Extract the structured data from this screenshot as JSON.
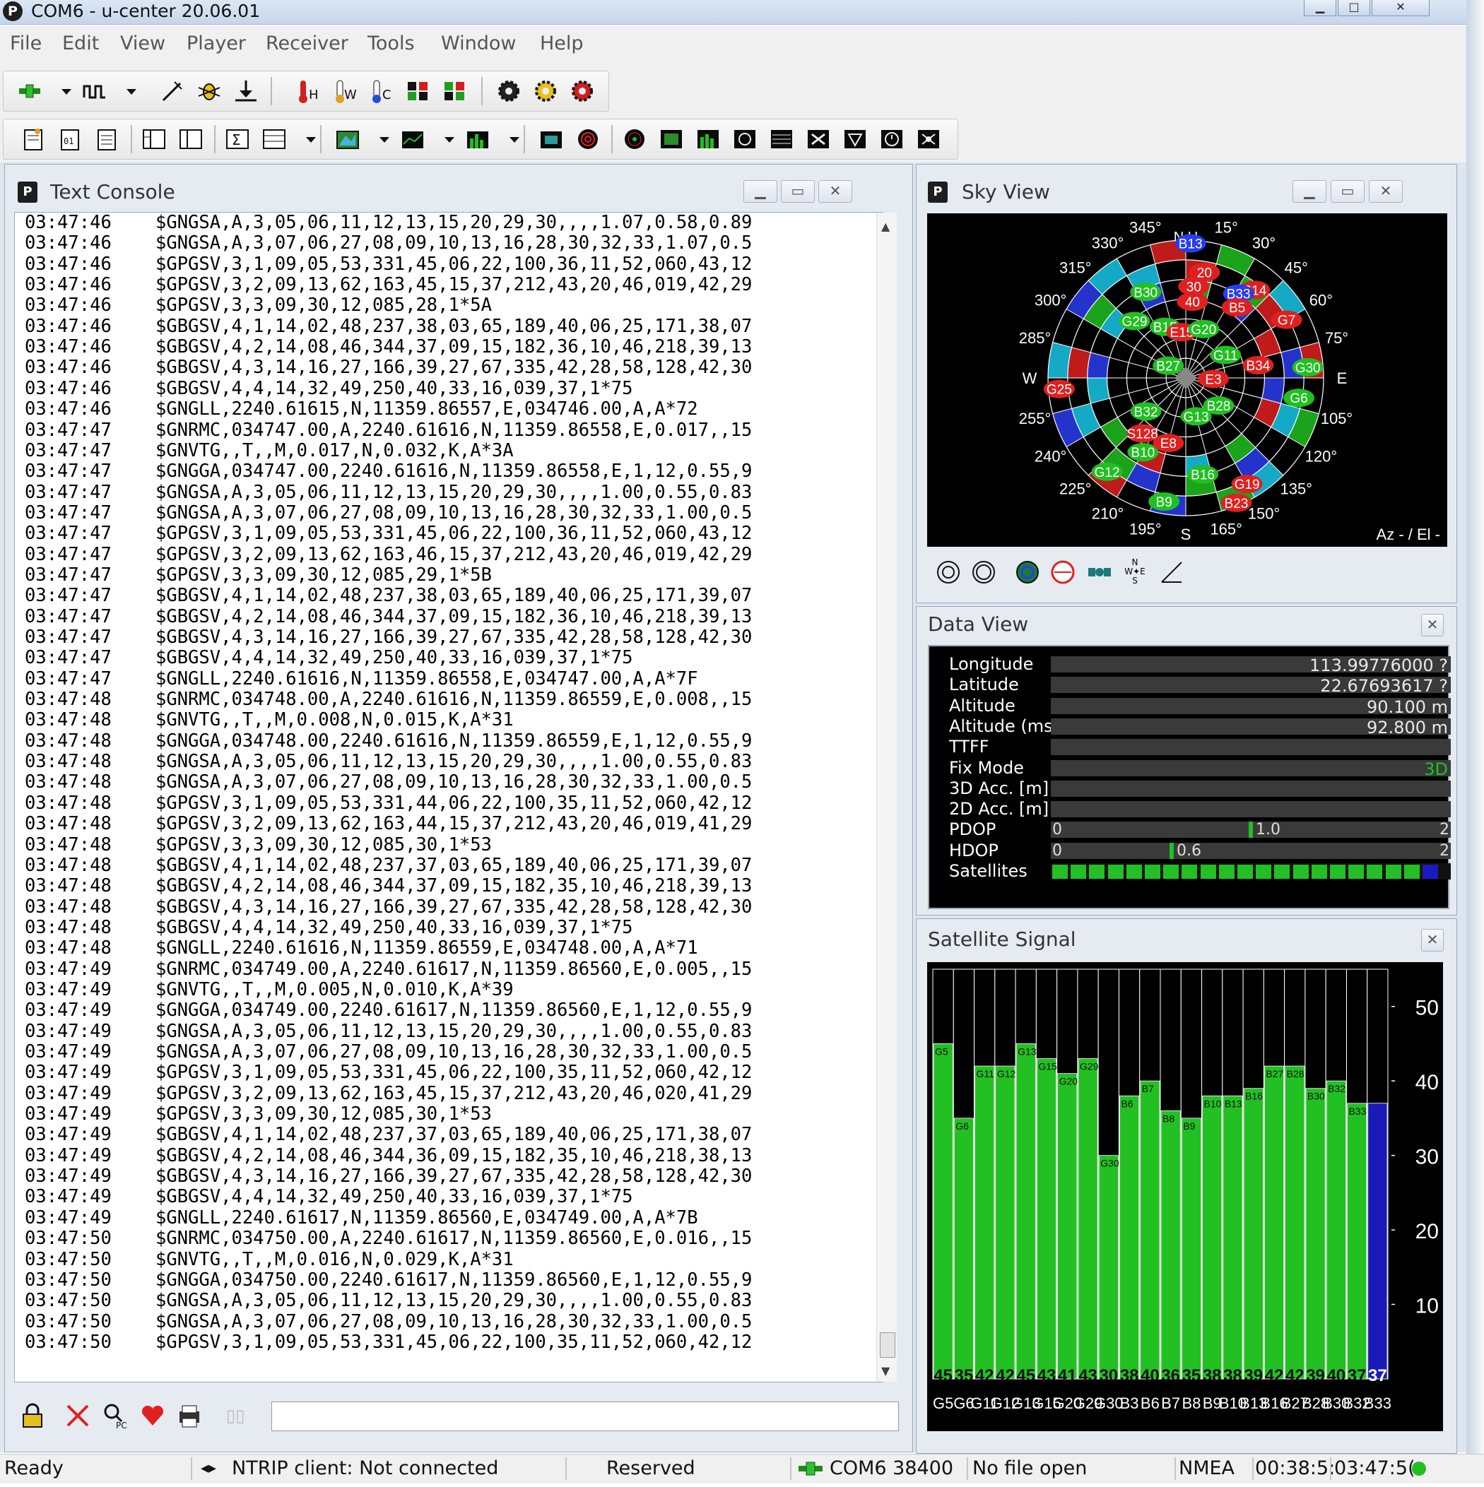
{
  "window": {
    "title": "COM6 - u-center 20.06.01",
    "app_icon": "P"
  },
  "menu": [
    "File",
    "Edit",
    "View",
    "Player",
    "Receiver",
    "Tools",
    "Window",
    "Help"
  ],
  "toolbar1_icons": [
    "connection-icon",
    "dropdown-icon",
    "baudrate-icon",
    "dropdown-icon",
    "autobaud-icon",
    "debug-icon",
    "download-icon",
    "hot-start-icon",
    "warm-start-icon",
    "cold-start-icon",
    "ubx-msg-icon",
    "ubx-cfg-icon",
    "gear-config-icon",
    "gear-send-icon",
    "gear-reset-icon"
  ],
  "toolbar2_icons": [
    "packet-console-icon",
    "binary-console-icon",
    "text-console-icon",
    "messages-view-icon",
    "data-view-icon",
    "statistics-icon",
    "table-view-icon",
    "dropdown-icon",
    "map-view-icon",
    "dropdown-icon",
    "chart-view-icon",
    "dropdown-icon",
    "histogram-icon",
    "dropdown-icon",
    "camera-view-icon",
    "sky-view-icon",
    "compass-icon",
    "deviation-map-icon",
    "signal-bars-icon",
    "spectrum-icon",
    "table-icon",
    "satellite-icon",
    "nav-icon",
    "clock-icon",
    "antenna-icon"
  ],
  "text_console": {
    "title": "Text Console",
    "lines": [
      [
        "03:47:46",
        "$GNGSA,A,3,05,06,11,12,13,15,20,29,30,,,,1.07,0.58,0.89"
      ],
      [
        "03:47:46",
        "$GNGSA,A,3,07,06,27,08,09,10,13,16,28,30,32,33,1.07,0.5"
      ],
      [
        "03:47:46",
        "$GPGSV,3,1,09,05,53,331,45,06,22,100,36,11,52,060,43,12"
      ],
      [
        "03:47:46",
        "$GPGSV,3,2,09,13,62,163,45,15,37,212,43,20,46,019,42,29"
      ],
      [
        "03:47:46",
        "$GPGSV,3,3,09,30,12,085,28,1*5A"
      ],
      [
        "03:47:46",
        "$GBGSV,4,1,14,02,48,237,38,03,65,189,40,06,25,171,38,07"
      ],
      [
        "03:47:46",
        "$GBGSV,4,2,14,08,46,344,37,09,15,182,36,10,46,218,39,13"
      ],
      [
        "03:47:46",
        "$GBGSV,4,3,14,16,27,166,39,27,67,335,42,28,58,128,42,30"
      ],
      [
        "03:47:46",
        "$GBGSV,4,4,14,32,49,250,40,33,16,039,37,1*75"
      ],
      [
        "03:47:46",
        "$GNGLL,2240.61615,N,11359.86557,E,034746.00,A,A*72"
      ],
      [
        "03:47:47",
        "$GNRMC,034747.00,A,2240.61616,N,11359.86558,E,0.017,,15"
      ],
      [
        "03:47:47",
        "$GNVTG,,T,,M,0.017,N,0.032,K,A*3A"
      ],
      [
        "03:47:47",
        "$GNGGA,034747.00,2240.61616,N,11359.86558,E,1,12,0.55,9"
      ],
      [
        "03:47:47",
        "$GNGSA,A,3,05,06,11,12,13,15,20,29,30,,,,1.00,0.55,0.83"
      ],
      [
        "03:47:47",
        "$GNGSA,A,3,07,06,27,08,09,10,13,16,28,30,32,33,1.00,0.5"
      ],
      [
        "03:47:47",
        "$GPGSV,3,1,09,05,53,331,45,06,22,100,36,11,52,060,43,12"
      ],
      [
        "03:47:47",
        "$GPGSV,3,2,09,13,62,163,46,15,37,212,43,20,46,019,42,29"
      ],
      [
        "03:47:47",
        "$GPGSV,3,3,09,30,12,085,29,1*5B"
      ],
      [
        "03:47:47",
        "$GBGSV,4,1,14,02,48,237,38,03,65,189,40,06,25,171,39,07"
      ],
      [
        "03:47:47",
        "$GBGSV,4,2,14,08,46,344,37,09,15,182,36,10,46,218,39,13"
      ],
      [
        "03:47:47",
        "$GBGSV,4,3,14,16,27,166,39,27,67,335,42,28,58,128,42,30"
      ],
      [
        "03:47:47",
        "$GBGSV,4,4,14,32,49,250,40,33,16,039,37,1*75"
      ],
      [
        "03:47:47",
        "$GNGLL,2240.61616,N,11359.86558,E,034747.00,A,A*7F"
      ],
      [
        "03:47:48",
        "$GNRMC,034748.00,A,2240.61616,N,11359.86559,E,0.008,,15"
      ],
      [
        "03:47:48",
        "$GNVTG,,T,,M,0.008,N,0.015,K,A*31"
      ],
      [
        "03:47:48",
        "$GNGGA,034748.00,2240.61616,N,11359.86559,E,1,12,0.55,9"
      ],
      [
        "03:47:48",
        "$GNGSA,A,3,05,06,11,12,13,15,20,29,30,,,,1.00,0.55,0.83"
      ],
      [
        "03:47:48",
        "$GNGSA,A,3,07,06,27,08,09,10,13,16,28,30,32,33,1.00,0.5"
      ],
      [
        "03:47:48",
        "$GPGSV,3,1,09,05,53,331,44,06,22,100,35,11,52,060,42,12"
      ],
      [
        "03:47:48",
        "$GPGSV,3,2,09,13,62,163,44,15,37,212,43,20,46,019,41,29"
      ],
      [
        "03:47:48",
        "$GPGSV,3,3,09,30,12,085,30,1*53"
      ],
      [
        "03:47:48",
        "$GBGSV,4,1,14,02,48,237,37,03,65,189,40,06,25,171,39,07"
      ],
      [
        "03:47:48",
        "$GBGSV,4,2,14,08,46,344,37,09,15,182,35,10,46,218,39,13"
      ],
      [
        "03:47:48",
        "$GBGSV,4,3,14,16,27,166,39,27,67,335,42,28,58,128,42,30"
      ],
      [
        "03:47:48",
        "$GBGSV,4,4,14,32,49,250,40,33,16,039,37,1*75"
      ],
      [
        "03:47:48",
        "$GNGLL,2240.61616,N,11359.86559,E,034748.00,A,A*71"
      ],
      [
        "03:47:49",
        "$GNRMC,034749.00,A,2240.61617,N,11359.86560,E,0.005,,15"
      ],
      [
        "03:47:49",
        "$GNVTG,,T,,M,0.005,N,0.010,K,A*39"
      ],
      [
        "03:47:49",
        "$GNGGA,034749.00,2240.61617,N,11359.86560,E,1,12,0.55,9"
      ],
      [
        "03:47:49",
        "$GNGSA,A,3,05,06,11,12,13,15,20,29,30,,,,1.00,0.55,0.83"
      ],
      [
        "03:47:49",
        "$GNGSA,A,3,07,06,27,08,09,10,13,16,28,30,32,33,1.00,0.5"
      ],
      [
        "03:47:49",
        "$GPGSV,3,1,09,05,53,331,45,06,22,100,35,11,52,060,42,12"
      ],
      [
        "03:47:49",
        "$GPGSV,3,2,09,13,62,163,45,15,37,212,43,20,46,020,41,29"
      ],
      [
        "03:47:49",
        "$GPGSV,3,3,09,30,12,085,30,1*53"
      ],
      [
        "03:47:49",
        "$GBGSV,4,1,14,02,48,237,37,03,65,189,40,06,25,171,38,07"
      ],
      [
        "03:47:49",
        "$GBGSV,4,2,14,08,46,344,36,09,15,182,35,10,46,218,38,13"
      ],
      [
        "03:47:49",
        "$GBGSV,4,3,14,16,27,166,39,27,67,335,42,28,58,128,42,30"
      ],
      [
        "03:47:49",
        "$GBGSV,4,4,14,32,49,250,40,33,16,039,37,1*75"
      ],
      [
        "03:47:49",
        "$GNGLL,2240.61617,N,11359.86560,E,034749.00,A,A*7B"
      ],
      [
        "03:47:50",
        "$GNRMC,034750.00,A,2240.61617,N,11359.86560,E,0.016,,15"
      ],
      [
        "03:47:50",
        "$GNVTG,,T,,M,0.016,N,0.029,K,A*31"
      ],
      [
        "03:47:50",
        "$GNGGA,034750.00,2240.61617,N,11359.86560,E,1,12,0.55,9"
      ],
      [
        "03:47:50",
        "$GNGSA,A,3,05,06,11,12,13,15,20,29,30,,,,1.00,0.55,0.83"
      ],
      [
        "03:47:50",
        "$GNGSA,A,3,07,06,27,08,09,10,13,16,28,30,32,33,1.00,0.5"
      ],
      [
        "03:47:50",
        "$GPGSV,3,1,09,05,53,331,45,06,22,100,35,11,52,060,42,12"
      ]
    ],
    "bottom_icons": [
      "lock-icon",
      "clear-icon",
      "pc-filter-icon",
      "heart-icon",
      "printer-icon",
      "pause-icon"
    ],
    "input_value": ""
  },
  "sky_view": {
    "title": "Sky View",
    "az_labels": [
      "345°",
      "15°",
      "30°",
      "45°",
      "60°",
      "75°",
      "E",
      "105°",
      "120°",
      "135°",
      "150°",
      "165°",
      "S",
      "195°",
      "210°",
      "225°",
      "240°",
      "255°",
      "W",
      "285°",
      "300°",
      "315°",
      "330°"
    ],
    "north_label": "N U",
    "corner_label": "Az - / El -",
    "satellites": [
      {
        "id": "B13",
        "color": "#2a3cf0",
        "az": 2,
        "el": 88
      },
      {
        "id": "20",
        "color": "#e02020",
        "az": 10,
        "el": 70
      },
      {
        "id": "30",
        "color": "#e02020",
        "az": 5,
        "el": 60
      },
      {
        "id": "40",
        "color": "#e02020",
        "az": 5,
        "el": 50
      },
      {
        "id": "B14",
        "color": "#e02020",
        "az": 38,
        "el": 73
      },
      {
        "id": "B33",
        "color": "#2a3cf0",
        "az": 32,
        "el": 65
      },
      {
        "id": "B5",
        "color": "#e02020",
        "az": 36,
        "el": 57
      },
      {
        "id": "G7",
        "color": "#e02020",
        "az": 60,
        "el": 76
      },
      {
        "id": "B30",
        "color": "#20c020",
        "az": 335,
        "el": 62
      },
      {
        "id": "G29",
        "color": "#20c020",
        "az": 318,
        "el": 50
      },
      {
        "id": "B15",
        "color": "#20c020",
        "az": 338,
        "el": 36
      },
      {
        "id": "E15",
        "color": "#e02020",
        "az": 355,
        "el": 30
      },
      {
        "id": "G20",
        "color": "#20c020",
        "az": 20,
        "el": 34
      },
      {
        "id": "B27",
        "color": "#20c020",
        "az": 305,
        "el": 14
      },
      {
        "id": "G11",
        "color": "#20c020",
        "az": 60,
        "el": 30
      },
      {
        "id": "B34",
        "color": "#e02020",
        "az": 80,
        "el": 48
      },
      {
        "id": "G30",
        "color": "#20c020",
        "az": 85,
        "el": 80
      },
      {
        "id": "E3",
        "color": "#e02020",
        "az": 92,
        "el": 18
      },
      {
        "id": "G6",
        "color": "#20c020",
        "az": 100,
        "el": 75
      },
      {
        "id": "G25",
        "color": "#e02020",
        "az": 265,
        "el": 83
      },
      {
        "id": "B32",
        "color": "#20c020",
        "az": 230,
        "el": 34
      },
      {
        "id": "S128",
        "color": "#e02020",
        "az": 218,
        "el": 46
      },
      {
        "id": "B28",
        "color": "#20c020",
        "az": 130,
        "el": 28
      },
      {
        "id": "G13",
        "color": "#20c020",
        "az": 165,
        "el": 26
      },
      {
        "id": "B10",
        "color": "#20c020",
        "az": 210,
        "el": 56
      },
      {
        "id": "E8",
        "color": "#e02020",
        "az": 195,
        "el": 44
      },
      {
        "id": "G12",
        "color": "#20c020",
        "az": 220,
        "el": 80
      },
      {
        "id": "B16",
        "color": "#20c020",
        "az": 170,
        "el": 64
      },
      {
        "id": "B9",
        "color": "#20c020",
        "az": 190,
        "el": 82
      },
      {
        "id": "G19",
        "color": "#e02020",
        "az": 150,
        "el": 80
      },
      {
        "id": "B23",
        "color": "#e02020",
        "az": 158,
        "el": 88
      }
    ],
    "toolbar_icons": [
      "polar-icon",
      "ring-icon",
      "sky-color-icon",
      "sky-red-icon",
      "satellite-icon",
      "compass-nwse-icon",
      "elevation-mask-icon"
    ]
  },
  "data_view": {
    "title": "Data View",
    "rows": [
      {
        "label": "Longitude",
        "value": "113.99776000 ?"
      },
      {
        "label": "Latitude",
        "value": "22.67693617 ?"
      },
      {
        "label": "Altitude",
        "value": "90.100 m"
      },
      {
        "label": "Altitude (msl)",
        "value": "92.800 m"
      },
      {
        "label": "TTFF",
        "value": ""
      },
      {
        "label": "Fix Mode",
        "value": "3D"
      },
      {
        "label": "3D Acc. [m]",
        "value": ""
      },
      {
        "label": "2D Acc. [m]",
        "value": ""
      }
    ],
    "pdop": {
      "label": "PDOP",
      "min": "0",
      "max": "2",
      "value": 1.0,
      "value_text": "1.0"
    },
    "hdop": {
      "label": "HDOP",
      "min": "0",
      "max": "2",
      "value": 0.6,
      "value_text": "0.6"
    },
    "satellites": {
      "label": "Satellites",
      "green_count": 20,
      "blue_count": 1
    }
  },
  "satellite_signal": {
    "title": "Satellite Signal",
    "y_ticks": [
      "50",
      "40",
      "30",
      "20",
      "10"
    ]
  },
  "chart_data": {
    "type": "bar",
    "title": "",
    "ylim": [
      0,
      55
    ],
    "grid": true,
    "categories": [
      "G5",
      "G6",
      "G11",
      "G12",
      "G13",
      "G15",
      "G20",
      "G29",
      "G30",
      "B3",
      "B6",
      "B7",
      "B8",
      "B9",
      "B10",
      "B13",
      "B16",
      "B27",
      "B28",
      "B30",
      "B32",
      "B33"
    ],
    "values": [
      45,
      35,
      42,
      42,
      45,
      43,
      41,
      43,
      30,
      38,
      40,
      36,
      35,
      38,
      38,
      39,
      42,
      42,
      39,
      40,
      37,
      37
    ],
    "value_labels": [
      "45",
      "35",
      "42",
      "42",
      "45",
      "43",
      "41",
      "43",
      "30",
      "38",
      "40",
      "36",
      "35",
      "38",
      "38",
      "39",
      "42",
      "42",
      "39",
      "40",
      "37",
      "37"
    ],
    "bar_colors": [
      "green",
      "green",
      "green",
      "green",
      "green",
      "green",
      "green",
      "green",
      "green",
      "green",
      "green",
      "green",
      "green",
      "green",
      "green",
      "green",
      "green",
      "green",
      "green",
      "green",
      "green",
      "blue"
    ],
    "bar_labels": [
      "G5",
      "G6",
      "G11",
      "G12",
      "G13",
      "G15",
      "G20",
      "G29",
      "G30",
      "B6",
      "B7",
      "B8",
      "B9",
      "B10",
      "B13",
      "B16",
      "B27",
      "B28",
      "B30",
      "B32",
      "B33"
    ],
    "series": [
      {
        "values": [
          45,
          35,
          42,
          42,
          45,
          43,
          41,
          43,
          30,
          38,
          40,
          36,
          35,
          38,
          38,
          39,
          42,
          42,
          39,
          40,
          37,
          37
        ]
      }
    ]
  },
  "statusbar": {
    "ready": "Ready",
    "ntrip": "NTRIP client: Not connected",
    "reserved": "Reserved",
    "port": "COM6 38400",
    "file": "No file open",
    "protocol": "NMEA",
    "elapsed": "00:38:5:",
    "time": "03:47:5("
  },
  "colors": {
    "accent_green": "#22c022",
    "accent_blue": "#1a1ab8",
    "sat_red": "#e02020"
  }
}
